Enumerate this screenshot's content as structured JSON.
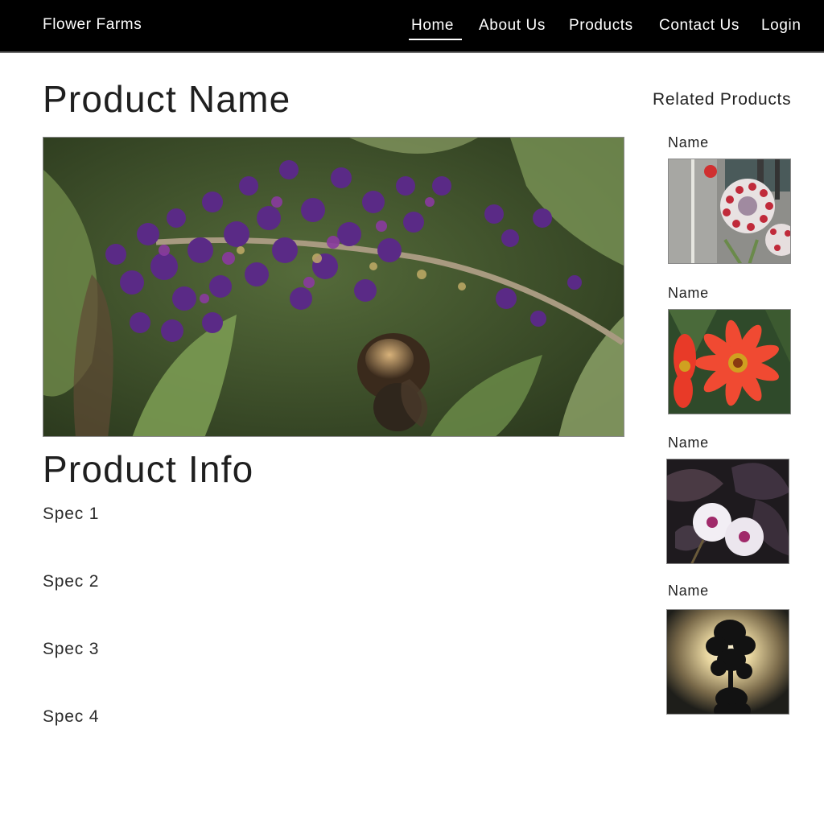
{
  "navbar": {
    "brand": "Flower Farms",
    "links": [
      {
        "label": "Home",
        "active": true
      },
      {
        "label": "About Us",
        "active": false
      },
      {
        "label": "Products",
        "active": false
      },
      {
        "label": "Contact Us",
        "active": false
      },
      {
        "label": "Login",
        "active": false
      }
    ]
  },
  "main": {
    "title": "Product Name",
    "info_title": "Product Info",
    "specs": [
      "Spec 1",
      "Spec 2",
      "Spec 3",
      "Spec 4"
    ]
  },
  "sidebar": {
    "title": "Related Products",
    "items": [
      {
        "name": "Name"
      },
      {
        "name": "Name"
      },
      {
        "name": "Name"
      },
      {
        "name": "Name"
      }
    ]
  },
  "colors": {
    "navbar_bg": "#000000",
    "text": "#1f1f1f",
    "flower_purple": "#5a2a86",
    "dahlia_red": "#f04a32"
  }
}
